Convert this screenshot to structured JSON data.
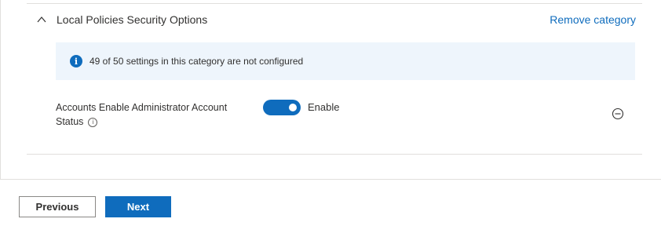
{
  "category": {
    "title": "Local Policies Security Options",
    "remove_label": "Remove category",
    "expanded": true
  },
  "info": {
    "message": "49 of 50 settings in this category are not configured",
    "icon": "info-icon"
  },
  "setting": {
    "label_line1": "Accounts Enable Administrator Account",
    "label_line2": "Status",
    "toggle_on": true,
    "toggle_label": "Enable"
  },
  "footer": {
    "previous_label": "Previous",
    "next_label": "Next"
  },
  "colors": {
    "accent": "#0f6cbd",
    "info_background": "#eef5fc"
  }
}
